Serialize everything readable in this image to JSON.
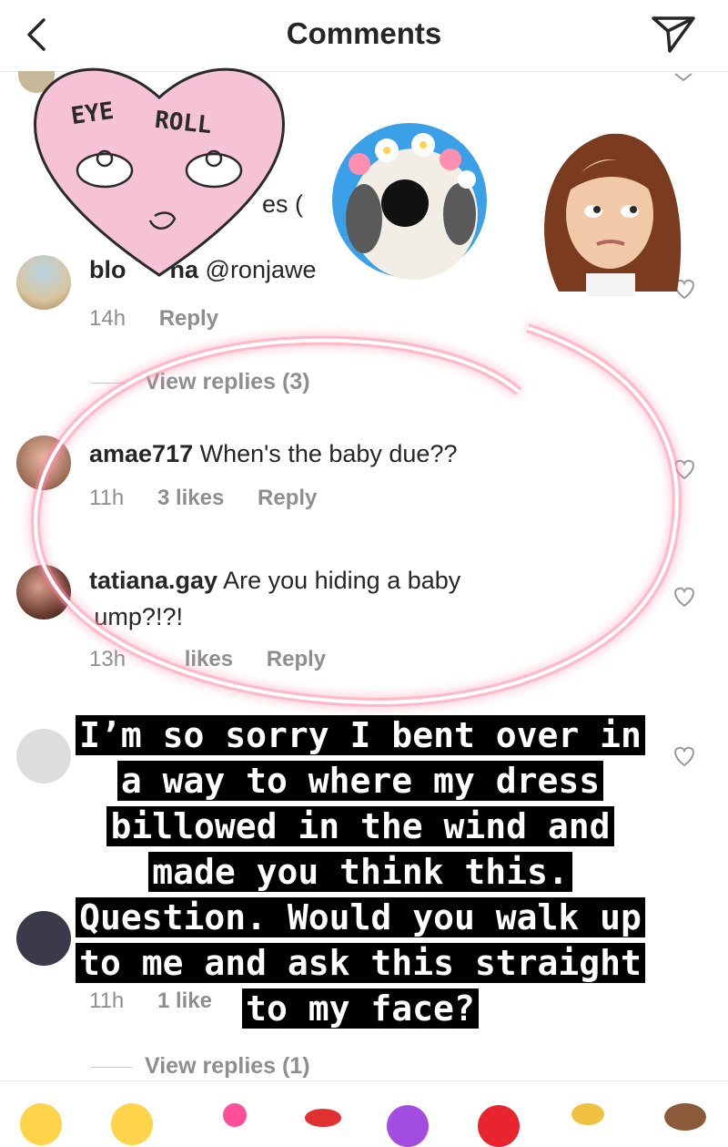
{
  "header": {
    "title": "Comments"
  },
  "stickers": {
    "eye_roll_line1": "EYE",
    "eye_roll_line2": "ROLL"
  },
  "comments": [
    {
      "username": "blo",
      "username_tail": "na",
      "text": "@ronjawe",
      "partial_above": "es (",
      "time": "14h",
      "reply": "Reply",
      "view_replies": "View replies (3)"
    },
    {
      "username": "amae717",
      "text": "When's the baby due??",
      "time": "11h",
      "likes": "3 likes",
      "reply": "Reply"
    },
    {
      "username": "tatiana.gay",
      "text": "Are you hiding a baby",
      "text_line2": " ump?!?!",
      "time": "13h",
      "likes": "likes",
      "reply": "Reply"
    },
    {
      "time": "11h",
      "likes": "1 like",
      "view_replies": "View replies (1)"
    }
  ],
  "caption_lines": [
    "I’m so sorry I bent over in",
    "a way to where my dress",
    "billowed in the wind and",
    "made you think this.",
    "Question. Would you walk up",
    "to me and ask this straight",
    "to my face?"
  ],
  "colors": {
    "glow": "#ff6f8f",
    "heart_sticker": "#f6c3d6",
    "dog_bg": "#3aa0e8",
    "meta_gray": "#8e8e8e"
  },
  "emoji_bar": [
    "grin-emoji",
    "smile-emoji",
    "heart-emoji",
    "lips-emoji",
    "purple-heart-emoji",
    "red-heart-emoji",
    "sparkle-emoji",
    "hand-emoji"
  ]
}
